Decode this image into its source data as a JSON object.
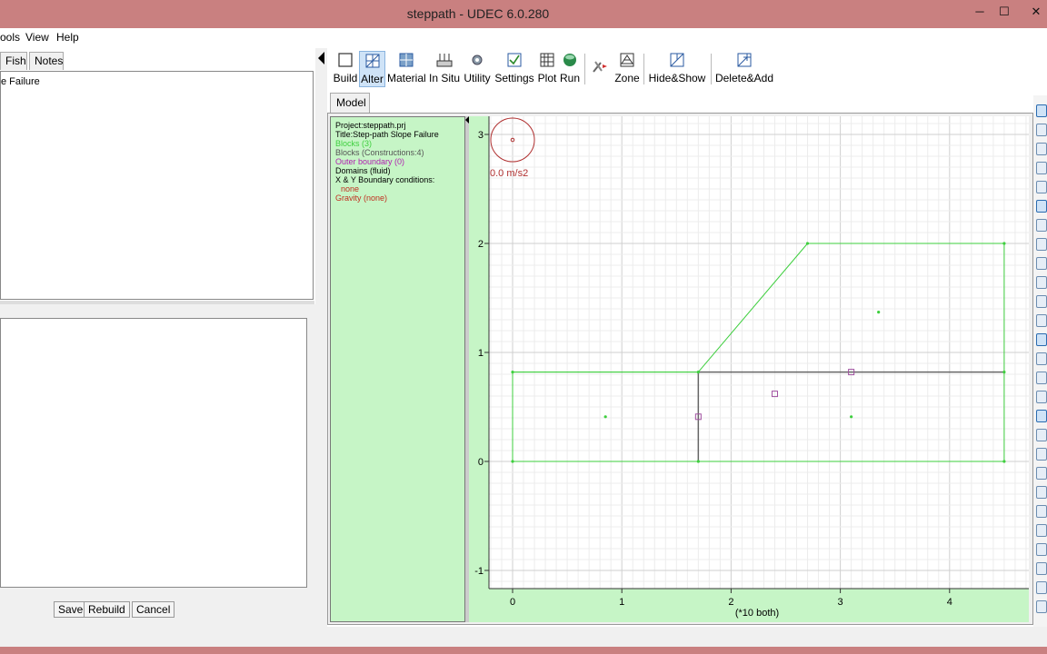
{
  "window": {
    "title": "steppath - UDEC 6.0.280",
    "minimize": "─",
    "maximize": "☐",
    "close": "✕"
  },
  "menu": {
    "items": [
      "ools",
      "View",
      "Help"
    ]
  },
  "left_panel": {
    "tabs": [
      "Fish",
      "Notes"
    ],
    "text_content": "e Failure",
    "buttons": {
      "save": "Save",
      "rebuild": "Rebuild",
      "cancel": "Cancel"
    }
  },
  "toolbar": {
    "items": [
      {
        "label": "Build",
        "icon": "square-icon"
      },
      {
        "label": "Alter",
        "icon": "alter-grid-icon",
        "active": true
      },
      {
        "label": "Material",
        "icon": "material-icon"
      },
      {
        "label": "In Situ",
        "icon": "insitu-icon"
      },
      {
        "label": "Utility",
        "icon": "gear-icon"
      },
      {
        "label": "Settings",
        "icon": "checkbox-icon"
      },
      {
        "label": "Plot",
        "icon": "plot-grid-icon"
      },
      {
        "label": "Run",
        "icon": "run-sphere-icon"
      },
      {
        "label": "",
        "icon": "tools-icon"
      },
      {
        "label": "Zone",
        "icon": "zone-icon"
      },
      {
        "label": "Hide&Show",
        "icon": "hide-show-icon"
      },
      {
        "label": "Delete&Add",
        "icon": "delete-add-icon"
      }
    ]
  },
  "model_tab": "Model",
  "info_panel": {
    "lines": [
      {
        "text": "Project:steppath.prj",
        "color": "#000000"
      },
      {
        "text": "Title:Step-path Slope Failure",
        "color": "#000000"
      },
      {
        "text": "Blocks (3)",
        "color": "#3ecf3e"
      },
      {
        "text": "Blocks (Constructions:4)",
        "color": "#555555"
      },
      {
        "text": "Outer boundary (0)",
        "color": "#b020b0"
      },
      {
        "text": "Domains (fluid)",
        "color": "#000000"
      },
      {
        "text": "X & Y Boundary conditions:",
        "color": "#000000"
      },
      {
        "text": "none",
        "color": "#c03020",
        "indent": true
      },
      {
        "text": "Gravity (none)",
        "color": "#c03020"
      }
    ]
  },
  "plot": {
    "gravity_text": "0.0 m/s2",
    "x_axis_label": "(*10 both)",
    "x_ticks": [
      "0",
      "1",
      "2",
      "3",
      "4"
    ],
    "y_ticks": [
      "3",
      "2",
      "1",
      "0",
      "-1"
    ],
    "colors": {
      "background": "#ffffff",
      "grid": "#e6e6e6",
      "block": "#3ecf3e",
      "joint": "#666666",
      "marker": "#a050a0",
      "gravity": "#b03030"
    }
  },
  "chart_data": {
    "type": "scatter",
    "xlabel": "(*10 both)",
    "xlim": [
      -0.2,
      4.7
    ],
    "ylim": [
      -1.2,
      3.2
    ],
    "x_ticks": [
      0,
      1,
      2,
      3,
      4
    ],
    "y_ticks": [
      -1,
      0,
      1,
      2,
      3
    ],
    "block_outline": [
      [
        0,
        0
      ],
      [
        4.5,
        0
      ],
      [
        4.5,
        2
      ],
      [
        2.7,
        2
      ],
      [
        1.7,
        0.82
      ],
      [
        0,
        0.82
      ],
      [
        0,
        0
      ]
    ],
    "joints": [
      [
        [
          1.7,
          0.82
        ],
        [
          4.5,
          0.82
        ]
      ],
      [
        [
          1.7,
          0
        ],
        [
          1.7,
          0.82
        ]
      ]
    ],
    "block_centroids": [
      [
        0.85,
        0.41
      ],
      [
        3.1,
        0.41
      ],
      [
        3.35,
        1.37
      ]
    ],
    "contact_markers": [
      [
        1.7,
        0.41
      ],
      [
        2.4,
        0.62
      ],
      [
        3.1,
        0.82
      ]
    ]
  }
}
